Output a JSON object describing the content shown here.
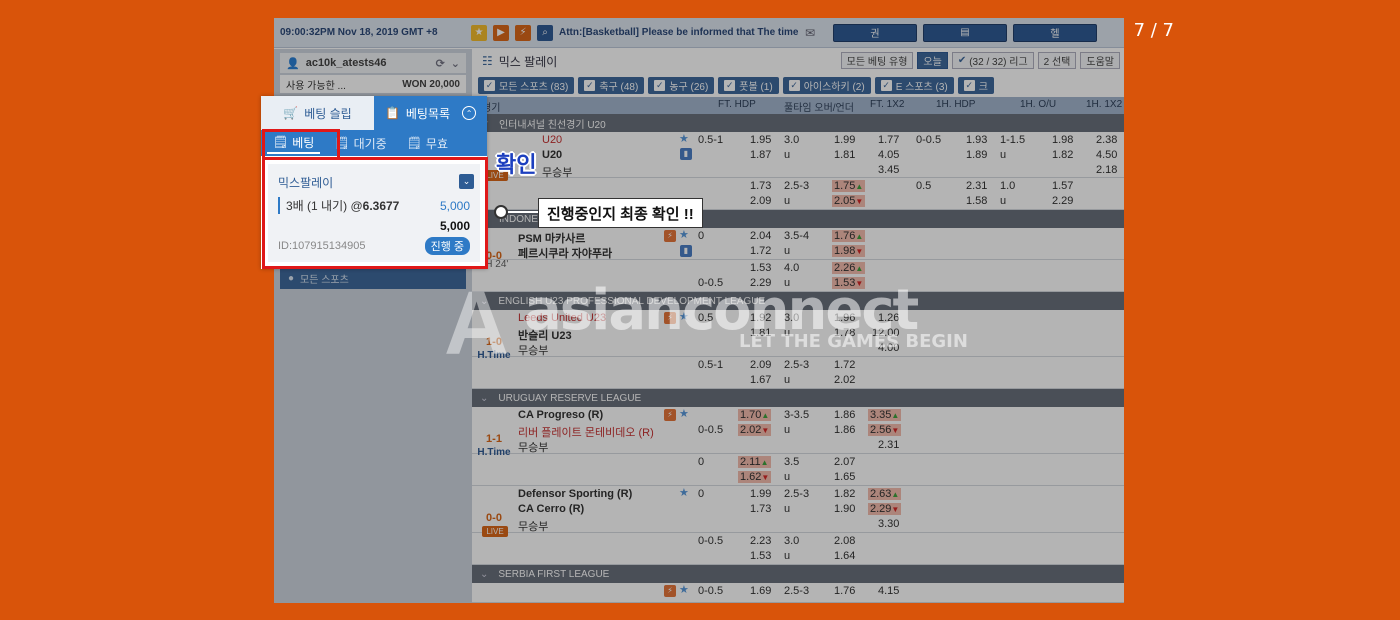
{
  "page_counter": "7 / 7",
  "topbar": {
    "time": "09:00:32PM Nov 18, 2019 GMT +8",
    "notice": "Attn:[Basketball] Please be informed that The timer",
    "buttons": [
      "권",
      "",
      "헬"
    ]
  },
  "sidebar": {
    "username": "ac10k_atests46",
    "available_label": "사용 가능한 ...",
    "available_value": "WON 20,000",
    "all_sports": "모든 스포츠"
  },
  "main": {
    "title": "믹스 팔레이",
    "controls": {
      "bet_type": "모든 베팅 유형",
      "today": "오늘",
      "league": "(32 / 32) 리그",
      "selection": "2 선택",
      "help": "도움말"
    },
    "sport_tabs": [
      "모든 스포츠 (83)",
      "축구 (48)",
      "농구 (26)",
      "풋볼 (1)",
      "아이스하키 (2)",
      "E 스포츠 (3)",
      "크"
    ],
    "columns": [
      "경기",
      "FT. HDP",
      "풀타임 오버/언더",
      "FT. 1X2",
      "1H. HDP",
      "1H. O/U",
      "1H. 1X2"
    ]
  },
  "leagues": {
    "l1": "인터내셔널 친선경기 U20",
    "l2": "INDONESIA LIGA 1",
    "l3": "ENGLISH U23 PROFESSIONAL DEVELOPMENT LEAGUE",
    "l4": "URUGUAY RESERVE LEAGUE",
    "l5": "SERBIA FIRST LEAGUE"
  },
  "matches": {
    "m1": {
      "team1": "U20",
      "team2": "U20",
      "draw": "무승부",
      "live": "LIVE",
      "r1": [
        "0.5-1",
        "1.95",
        "3.0",
        "1.99",
        "1.77",
        "0-0.5",
        "1.93",
        "1-1.5",
        "1.98",
        "2.38"
      ],
      "r2": [
        "1.87",
        "u",
        "1.81",
        "4.05",
        "1.89",
        "u",
        "1.82",
        "4.50"
      ],
      "r3": [
        "3.45",
        "2.18"
      ],
      "r4": [
        "1.73",
        "2.5-3",
        "1.75",
        "0.5",
        "2.31",
        "1.0",
        "1.57"
      ],
      "r5": [
        "2.09",
        "u",
        "2.05",
        "1.58",
        "u",
        "2.29"
      ]
    },
    "m2": {
      "team1": "PSM 마카사르",
      "team2": "페르시쿠라 자야푸라",
      "score": "0-0",
      "time": "2H 24'",
      "r1": [
        "0",
        "2.04",
        "3.5-4",
        "1.76"
      ],
      "r2": [
        "1.72",
        "u",
        "1.98"
      ],
      "r3": [
        "1.53",
        "4.0",
        "2.26"
      ],
      "r4": [
        "0-0.5",
        "2.29",
        "u",
        "1.53"
      ]
    },
    "m3": {
      "team1": "Leeds United U23",
      "team2": "반슬리 U23",
      "draw": "무승부",
      "score": "1-0",
      "time": "H.Time",
      "r1": [
        "0.5",
        "1.92",
        "3.0",
        "1.96",
        "1.26"
      ],
      "r2": [
        "1.81",
        "u",
        "1.78",
        "12.00"
      ],
      "r3": [
        "4.00"
      ],
      "r4": [
        "0.5-1",
        "2.09",
        "2.5-3",
        "1.72"
      ],
      "r5": [
        "1.67",
        "u",
        "2.02"
      ]
    },
    "m4": {
      "team1": "CA Progreso (R)",
      "team2": "리버 플레이트 몬테비데오 (R)",
      "draw": "무승부",
      "score": "1-1",
      "time": "H.Time",
      "r1": [
        "1.70",
        "3-3.5",
        "1.86",
        "3.35"
      ],
      "r2": [
        "0-0.5",
        "2.02",
        "u",
        "1.86",
        "2.56"
      ],
      "r3": [
        "2.31"
      ],
      "r4": [
        "0",
        "2.11",
        "3.5",
        "2.07"
      ],
      "r5": [
        "1.62",
        "u",
        "1.65"
      ]
    },
    "m5": {
      "team1": "Defensor Sporting (R)",
      "team2": "CA Cerro (R)",
      "draw": "무승부",
      "score": "0-0",
      "live": "LIVE",
      "r1": [
        "0",
        "1.99",
        "2.5-3",
        "1.82",
        "2.63"
      ],
      "r2": [
        "1.73",
        "u",
        "1.90",
        "2.29"
      ],
      "r3": [
        "3.30"
      ],
      "r4": [
        "0-0.5",
        "2.23",
        "3.0",
        "2.08"
      ],
      "r5": [
        "1.53",
        "u",
        "1.64"
      ]
    },
    "m6": {
      "r1": [
        "0-0.5",
        "1.69",
        "2.5-3",
        "1.76",
        "4.15"
      ]
    }
  },
  "watermark": {
    "brand": "asianconnect",
    "tagline": "LET THE GAMES BEGIN"
  },
  "panel": {
    "tab_slip": "베팅 슬립",
    "tab_list": "베팅목록",
    "sub_bet": "베팅",
    "sub_waiting": "대기중",
    "sub_void": "무효",
    "ticket_title": "믹스팔레이",
    "ticket_line_prefix": "3배 (1 내기) @",
    "ticket_odds": "6.3677",
    "ticket_amount": "5,000",
    "ticket_total": "5,000",
    "ticket_id": "ID:107915134905",
    "ticket_status": "진행 중"
  },
  "annotation": {
    "confirm": "확인",
    "callout": "진행중인지 최종 확인 !!"
  },
  "colors": {
    "background": "#d9540a",
    "accent_blue": "#2e7ac6",
    "highlight_red": "#e01818",
    "label_blue": "#1c3fbf"
  }
}
